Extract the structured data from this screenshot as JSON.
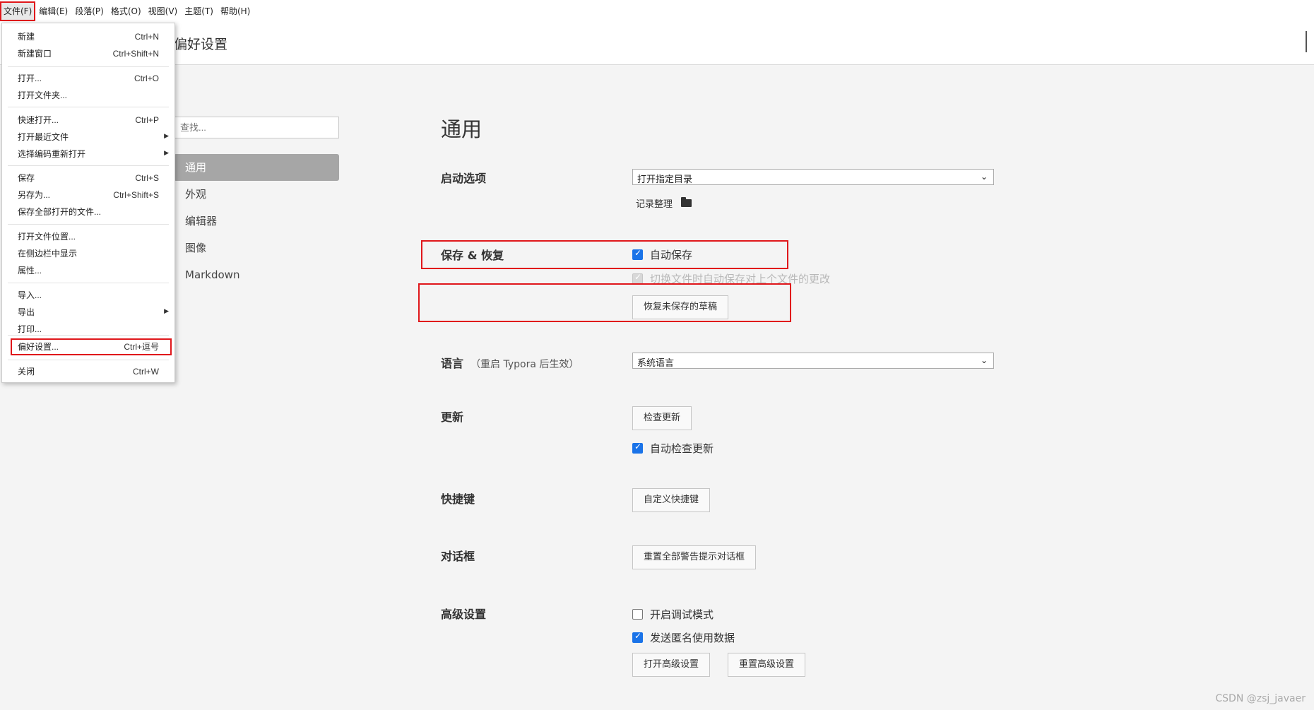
{
  "menubar": {
    "items": [
      "文件(F)",
      "编辑(E)",
      "段落(P)",
      "格式(O)",
      "视图(V)",
      "主题(T)",
      "帮助(H)"
    ]
  },
  "titlebar": {
    "title": "偏好设置"
  },
  "sidebar": {
    "search_placeholder": "查找...",
    "items": [
      "通用",
      "外观",
      "编辑器",
      "图像",
      "Markdown"
    ]
  },
  "main": {
    "heading": "通用",
    "startup": {
      "label": "启动选项",
      "select_value": "打开指定目录",
      "directory": "记录整理"
    },
    "save": {
      "label": "保存 & 恢复",
      "autosave": "自动保存",
      "switch_save": "切换文件时自动保存对上个文件的更改",
      "restore_button": "恢复未保存的草稿"
    },
    "language": {
      "label": "语言",
      "note": "（重启 Typora 后生效）",
      "select_value": "系统语言"
    },
    "update": {
      "label": "更新",
      "check_button": "检查更新",
      "auto_check": "自动检查更新"
    },
    "shortcuts": {
      "label": "快捷键",
      "button": "自定义快捷键"
    },
    "dialogs": {
      "label": "对话框",
      "button": "重置全部警告提示对话框"
    },
    "advanced": {
      "label": "高级设置",
      "debug": "开启调试模式",
      "anon_data": "发送匿名使用数据",
      "open_button": "打开高级设置",
      "reset_button": "重置高级设置"
    }
  },
  "file_menu": {
    "items": [
      {
        "label": "新建",
        "shortcut": "Ctrl+N"
      },
      {
        "label": "新建窗口",
        "shortcut": "Ctrl+Shift+N"
      },
      {
        "label": "打开...",
        "shortcut": "Ctrl+O"
      },
      {
        "label": "打开文件夹...",
        "shortcut": ""
      },
      {
        "label": "快速打开...",
        "shortcut": "Ctrl+P"
      },
      {
        "label": "打开最近文件",
        "shortcut": ""
      },
      {
        "label": "选择编码重新打开",
        "shortcut": ""
      },
      {
        "label": "保存",
        "shortcut": "Ctrl+S"
      },
      {
        "label": "另存为...",
        "shortcut": "Ctrl+Shift+S"
      },
      {
        "label": "保存全部打开的文件...",
        "shortcut": ""
      },
      {
        "label": "打开文件位置...",
        "shortcut": ""
      },
      {
        "label": "在侧边栏中显示",
        "shortcut": ""
      },
      {
        "label": "属性...",
        "shortcut": ""
      },
      {
        "label": "导入...",
        "shortcut": ""
      },
      {
        "label": "导出",
        "shortcut": ""
      },
      {
        "label": "打印...",
        "shortcut": ""
      },
      {
        "label": "偏好设置...",
        "shortcut": "Ctrl+逗号"
      },
      {
        "label": "关闭",
        "shortcut": "Ctrl+W"
      }
    ]
  },
  "watermark": "CSDN @zsj_javaer",
  "colors": {
    "highlight_red": "#e0171b",
    "checkbox_blue": "#1a73e8",
    "sidebar_active": "#a6a6a6"
  }
}
